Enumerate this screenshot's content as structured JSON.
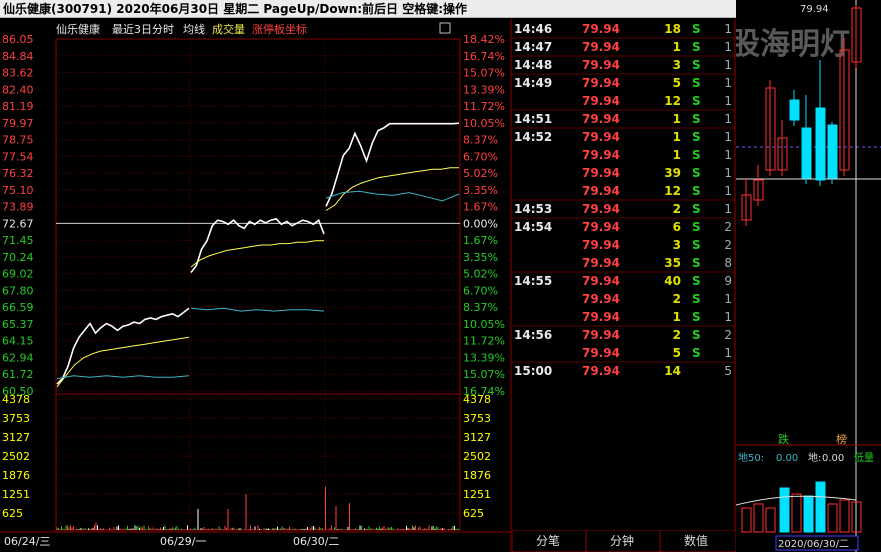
{
  "window": {
    "title": "仙乐健康(300791)  2020年06月30日  星期二  PageUp/Down:前后日  空格键:操作"
  },
  "header": {
    "stock": "仙乐健康",
    "range_label": "最近3日分时",
    "avg_label": "均线",
    "vol_label": "成交量",
    "limit_label": "涨停板坐标"
  },
  "colors": {
    "price_line": "#ffffff",
    "avg_line": "#ffff55",
    "flow_line": "#3cb4c8",
    "up": "#ff4040",
    "down": "#22cc22",
    "neutral": "#ffffff",
    "grid": "#8b0000",
    "buy": "#e0e000",
    "volume_col": "#ffff00"
  },
  "price_axis": {
    "left": [
      "86.05",
      "84.84",
      "83.62",
      "82.40",
      "81.19",
      "79.97",
      "78.75",
      "77.54",
      "76.32",
      "75.10",
      "73.89",
      "72.67",
      "71.45",
      "70.24",
      "69.02",
      "67.80",
      "66.59",
      "65.37",
      "64.15",
      "62.94",
      "61.72",
      "60.50"
    ],
    "right": [
      "18.42%",
      "16.74%",
      "15.07%",
      "13.39%",
      "11.72%",
      "10.05%",
      "8.37%",
      "6.70%",
      "5.02%",
      "3.35%",
      "1.67%",
      "0.00%",
      "1.67%",
      "3.35%",
      "5.02%",
      "6.70%",
      "8.37%",
      "10.05%",
      "11.72%",
      "13.39%",
      "15.07%",
      "16.74%"
    ],
    "prev_close": "72.67"
  },
  "volume_axis": {
    "labels": [
      "4378",
      "3753",
      "3127",
      "2502",
      "1876",
      "1251",
      "625"
    ]
  },
  "date_axis": [
    "06/24/三",
    "06/29/一",
    "06/30/二"
  ],
  "ticks": {
    "rows": [
      {
        "time": "14:46",
        "price": "79.94",
        "vol": "18",
        "side": "S",
        "n": "1"
      },
      {
        "time": "14:47",
        "price": "79.94",
        "vol": "1",
        "side": "S",
        "n": "1"
      },
      {
        "time": "14:48",
        "price": "79.94",
        "vol": "3",
        "side": "S",
        "n": "1"
      },
      {
        "time": "14:49",
        "price": "79.94",
        "vol": "5",
        "side": "S",
        "n": "1"
      },
      {
        "time": "",
        "price": "79.94",
        "vol": "12",
        "side": "S",
        "n": "1"
      },
      {
        "time": "14:51",
        "price": "79.94",
        "vol": "1",
        "side": "S",
        "n": "1"
      },
      {
        "time": "14:52",
        "price": "79.94",
        "vol": "1",
        "side": "S",
        "n": "1"
      },
      {
        "time": "",
        "price": "79.94",
        "vol": "1",
        "side": "S",
        "n": "1"
      },
      {
        "time": "",
        "price": "79.94",
        "vol": "39",
        "side": "S",
        "n": "1"
      },
      {
        "time": "",
        "price": "79.94",
        "vol": "12",
        "side": "S",
        "n": "1"
      },
      {
        "time": "14:53",
        "price": "79.94",
        "vol": "2",
        "side": "S",
        "n": "1"
      },
      {
        "time": "14:54",
        "price": "79.94",
        "vol": "6",
        "side": "S",
        "n": "2"
      },
      {
        "time": "",
        "price": "79.94",
        "vol": "3",
        "side": "S",
        "n": "2"
      },
      {
        "time": "",
        "price": "79.94",
        "vol": "35",
        "side": "S",
        "n": "8"
      },
      {
        "time": "14:55",
        "price": "79.94",
        "vol": "40",
        "side": "S",
        "n": "9"
      },
      {
        "time": "",
        "price": "79.94",
        "vol": "2",
        "side": "S",
        "n": "1"
      },
      {
        "time": "",
        "price": "79.94",
        "vol": "1",
        "side": "S",
        "n": "1"
      },
      {
        "time": "14:56",
        "price": "79.94",
        "vol": "2",
        "side": "S",
        "n": "2"
      },
      {
        "time": "",
        "price": "79.94",
        "vol": "5",
        "side": "S",
        "n": "1"
      },
      {
        "time": "15:00",
        "price": "79.94",
        "vol": "14",
        "side": "",
        "n": "5"
      }
    ],
    "tabs": [
      "分笔",
      "分钟",
      "数值"
    ]
  },
  "mini": {
    "top_price": "79.94",
    "watermark": "股海明灯",
    "label_down": "跌",
    "label_list": "榜",
    "indicator_label": "地50:",
    "indicator_value": "0.00",
    "ground_label": "地:",
    "ground_value": "0.00",
    "low_label": "低量",
    "date": "2020/06/30/二"
  },
  "chart_data": {
    "type": "line",
    "title": "仙乐健康 最近3日分时",
    "prev_close": 72.67,
    "ylim": [
      60.5,
      86.05
    ],
    "days": [
      "06/24/三",
      "06/29/一",
      "06/30/二"
    ],
    "series": [
      {
        "name": "price",
        "values": [
          [
            61.0,
            61.4,
            62.3,
            63.6,
            64.4,
            64.9,
            65.4,
            64.7,
            65.1,
            65.4,
            65.2,
            64.9,
            65.2,
            65.3,
            65.5,
            65.4,
            65.7,
            65.8,
            65.7,
            65.9,
            66.0,
            66.1,
            65.9,
            66.2,
            66.5
          ],
          [
            69.1,
            69.6,
            70.8,
            71.4,
            72.5,
            72.9,
            72.8,
            72.6,
            72.9,
            72.5,
            72.3,
            72.8,
            72.6,
            72.9,
            72.7,
            72.9,
            73.0,
            72.6,
            72.8,
            72.5,
            72.7,
            72.9,
            72.8,
            72.6,
            72.9,
            71.9
          ],
          [
            73.9,
            74.8,
            76.2,
            77.6,
            78.1,
            79.2,
            78.3,
            77.2,
            78.5,
            79.4,
            79.6,
            79.9,
            79.9,
            79.9,
            79.9,
            79.9,
            79.9,
            79.9,
            79.9,
            79.9,
            79.9,
            79.9,
            79.9,
            79.94
          ]
        ]
      },
      {
        "name": "均线",
        "values": [
          [
            60.8,
            61.6,
            62.4,
            62.9,
            63.2,
            63.4,
            63.5,
            63.6,
            63.7,
            63.8,
            63.9,
            64.0,
            64.1,
            64.2,
            64.3,
            64.4
          ],
          [
            69.5,
            70.0,
            70.3,
            70.5,
            70.7,
            70.8,
            70.9,
            71.0,
            71.1,
            71.1,
            71.2,
            71.2,
            71.3,
            71.3,
            71.4,
            71.4
          ],
          [
            73.6,
            74.0,
            74.8,
            75.3,
            75.6,
            75.8,
            76.0,
            76.1,
            76.2,
            76.3,
            76.4,
            76.5,
            76.6,
            76.6,
            76.7,
            76.7
          ]
        ]
      }
    ],
    "volume_ylim": [
      0,
      4378
    ]
  }
}
